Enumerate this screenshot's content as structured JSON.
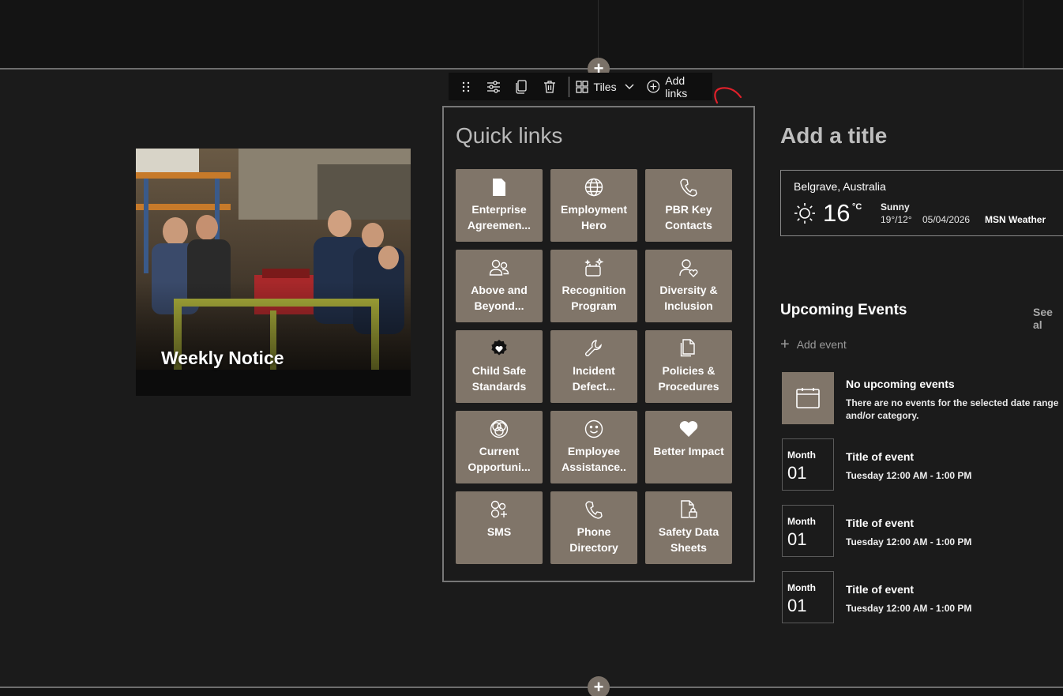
{
  "toolbar": {
    "layout_label": "Tiles",
    "add_links_label": "Add links"
  },
  "image_card": {
    "caption": "Weekly Notice"
  },
  "quick_links": {
    "title": "Quick links",
    "tiles": [
      {
        "label": "Enterprise Agreemen...",
        "icon": "page-icon"
      },
      {
        "label": "Employment Hero",
        "icon": "globe-icon"
      },
      {
        "label": "PBR Key Contacts",
        "icon": "phone-icon"
      },
      {
        "label": "Above and Beyond...",
        "icon": "people-icon"
      },
      {
        "label": "Recognition Program",
        "icon": "sparkle-icon"
      },
      {
        "label": "Diversity & Inclusion",
        "icon": "person-heart-icon"
      },
      {
        "label": "Child Safe Standards",
        "icon": "badge-heart-icon"
      },
      {
        "label": "Incident Defect...",
        "icon": "wrench-icon"
      },
      {
        "label": "Policies & Procedures",
        "icon": "documents-icon"
      },
      {
        "label": "Current Opportuni...",
        "icon": "circles-icon"
      },
      {
        "label": "Employee Assistance..",
        "icon": "smile-icon"
      },
      {
        "label": "Better Impact",
        "icon": "heart-icon"
      },
      {
        "label": "SMS",
        "icon": "people-add-icon"
      },
      {
        "label": "Phone Directory",
        "icon": "phone-icon"
      },
      {
        "label": "Safety Data Sheets",
        "icon": "document-lock-icon"
      }
    ]
  },
  "title_placeholder": "Add a title",
  "weather": {
    "location": "Belgrave, Australia",
    "temperature": "16",
    "unit": "°C",
    "condition": "Sunny",
    "range": "19°/12°",
    "date": "05/04/2026",
    "source": "MSN Weather"
  },
  "events": {
    "title": "Upcoming Events",
    "see_all": "See al",
    "add_event": "Add event",
    "no_events_title": "No upcoming events",
    "no_events_desc": "There are no events for the selected date range and/or category.",
    "items": [
      {
        "month": "Month",
        "day": "01",
        "title": "Title of event",
        "time": "Tuesday 12:00 AM - 1:00 PM"
      },
      {
        "month": "Month",
        "day": "01",
        "title": "Title of event",
        "time": "Tuesday 12:00 AM - 1:00 PM"
      },
      {
        "month": "Month",
        "day": "01",
        "title": "Title of event",
        "time": "Tuesday 12:00 AM - 1:00 PM"
      }
    ]
  },
  "colors": {
    "background": "#1b1b1b",
    "tile": "#807569",
    "annotation": "#e0202a"
  }
}
